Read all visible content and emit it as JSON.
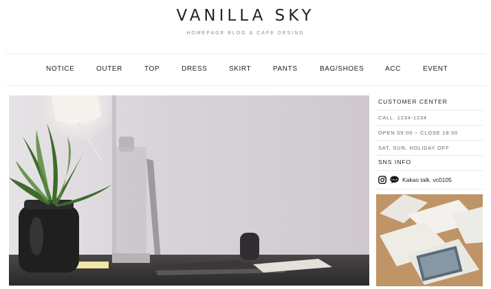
{
  "header": {
    "logo": "VANILLA SKY",
    "tagline": "HOMEPAGE BLOG & CAFE DESING"
  },
  "nav": {
    "items": [
      {
        "label": "NOTICE"
      },
      {
        "label": "OUTER"
      },
      {
        "label": "TOP"
      },
      {
        "label": "DRESS"
      },
      {
        "label": "SKIRT"
      },
      {
        "label": "PANTS"
      },
      {
        "label": "BAG/SHOES"
      },
      {
        "label": "ACC"
      },
      {
        "label": "EVENT"
      }
    ]
  },
  "sidebar": {
    "customer_center_title": "CUSTOMER CENTER",
    "call": "CALL. 1234-1234",
    "hours": "OPEN 09:00 ~ CLOSE 18:00",
    "holiday": "SAT, SUN, HOLIDAY OFF",
    "sns_title": "SNS INFO",
    "kakao": "Kakao talk. vc0105"
  },
  "icons": {
    "instagram": "instagram-icon",
    "kakao": "kakao-talk-icon"
  },
  "colors": {
    "text": "#222222",
    "muted": "#888888",
    "divider": "#ececec"
  }
}
